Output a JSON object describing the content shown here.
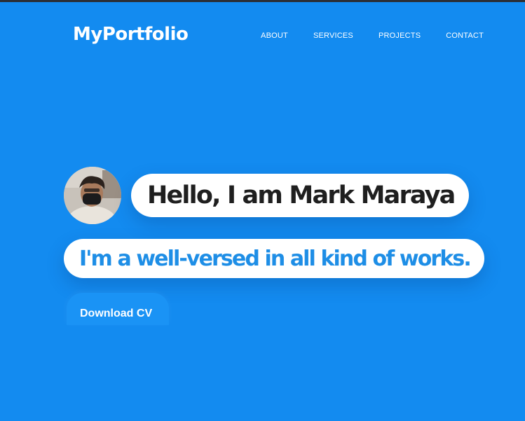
{
  "header": {
    "logo": "MyPortfolio",
    "nav": [
      {
        "label": "ABOUT"
      },
      {
        "label": "SERVICES"
      },
      {
        "label": "PROJECTS"
      },
      {
        "label": "CONTACT"
      }
    ]
  },
  "hero": {
    "greeting": "Hello, I am Mark Maraya",
    "tagline": "I'm a well-versed in all kind of works.",
    "cta_label": "Download CV"
  },
  "colors": {
    "background": "#138bf0",
    "accent_text": "#1e8ee6",
    "dark_text": "#1f1f1f"
  }
}
